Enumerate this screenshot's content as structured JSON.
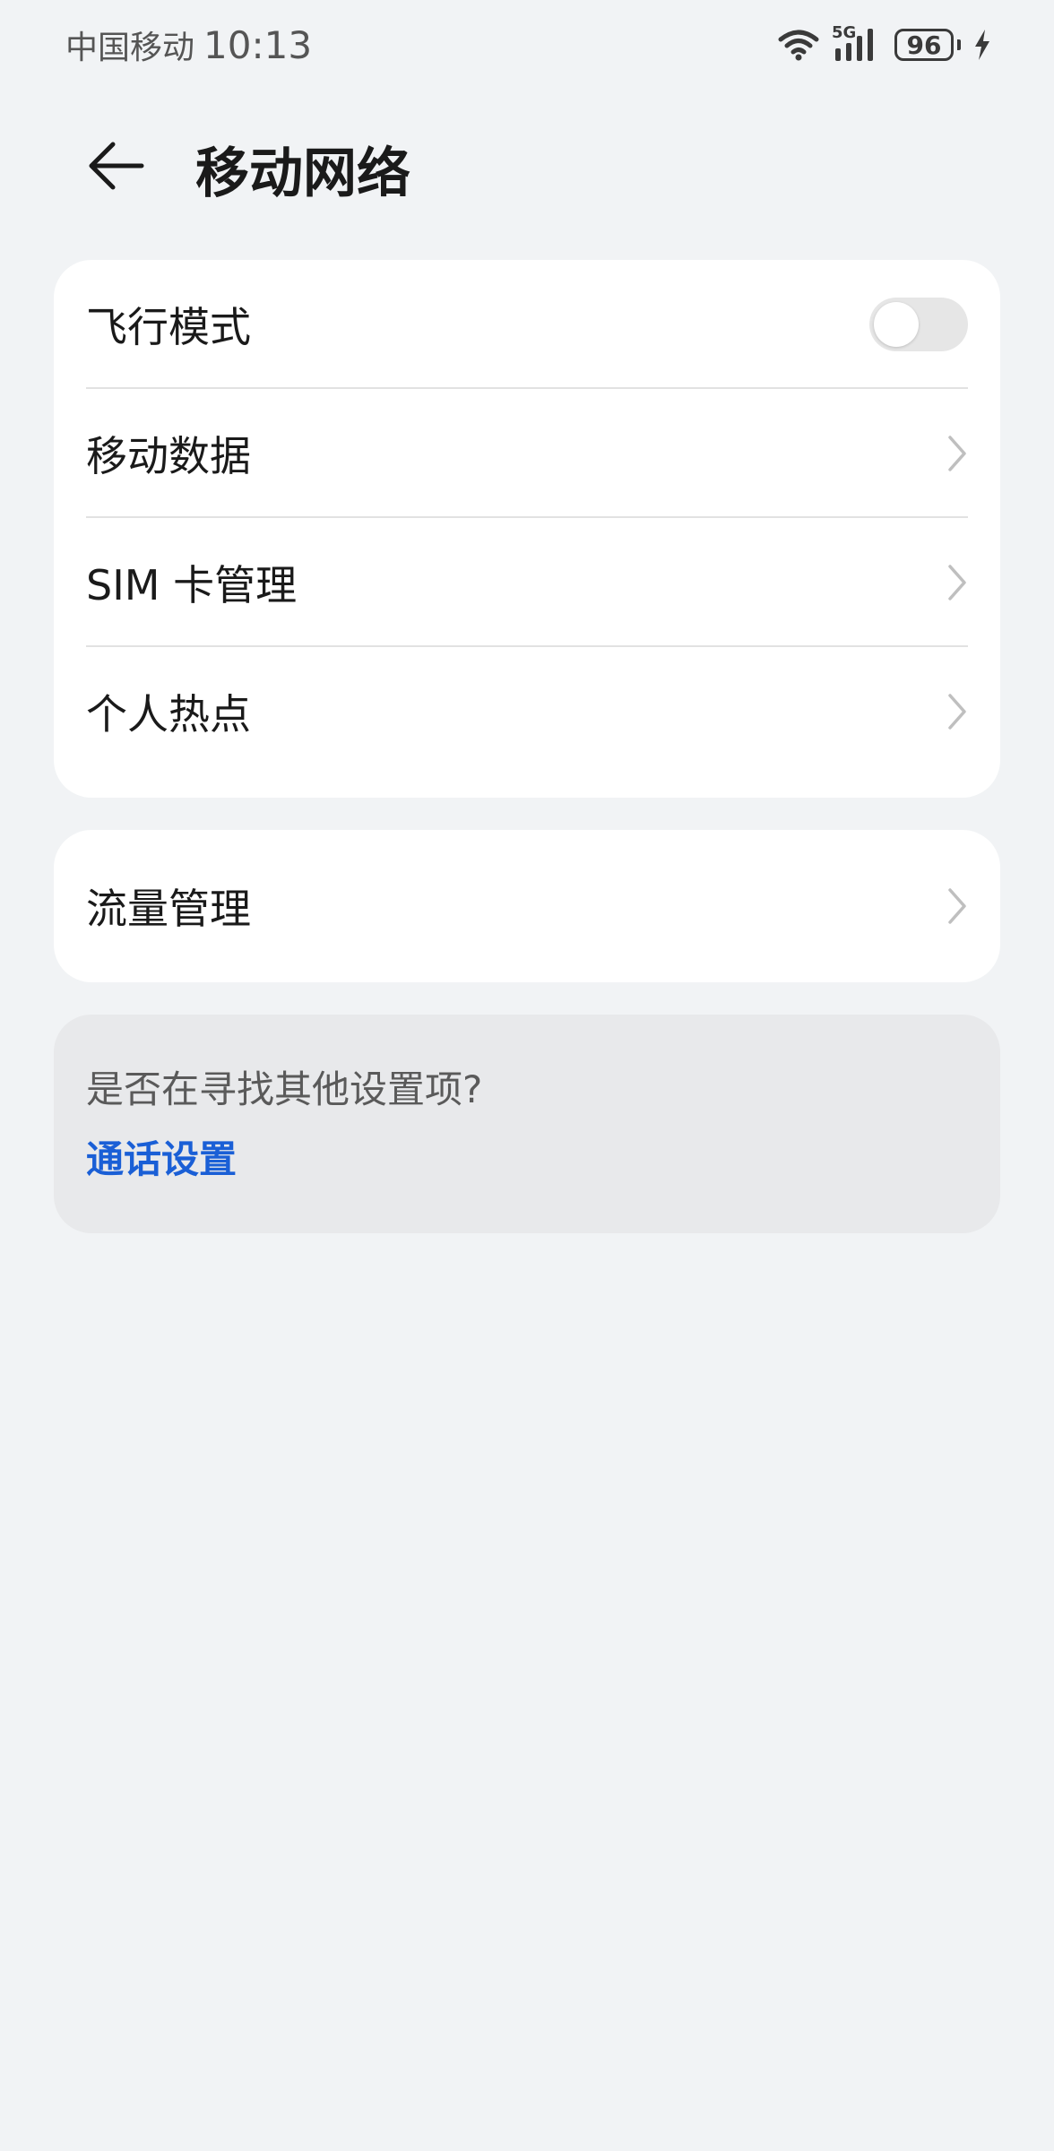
{
  "status_bar": {
    "carrier": "中国移动",
    "time": "10:13",
    "network": "5G",
    "battery": "96"
  },
  "header": {
    "title": "移动网络"
  },
  "settings_group_1": {
    "airplane_mode": {
      "label": "飞行模式",
      "enabled": false
    },
    "mobile_data": {
      "label": "移动数据"
    },
    "sim_management": {
      "label": "SIM 卡管理"
    },
    "hotspot": {
      "label": "个人热点"
    }
  },
  "settings_group_2": {
    "data_usage": {
      "label": "流量管理"
    }
  },
  "suggestions": {
    "question": "是否在寻找其他设置项?",
    "link": "通话设置"
  },
  "colors": {
    "background": "#f1f3f5",
    "card": "#ffffff",
    "link": "#1a5fd6",
    "toggle_off": "#e6e6e6"
  }
}
